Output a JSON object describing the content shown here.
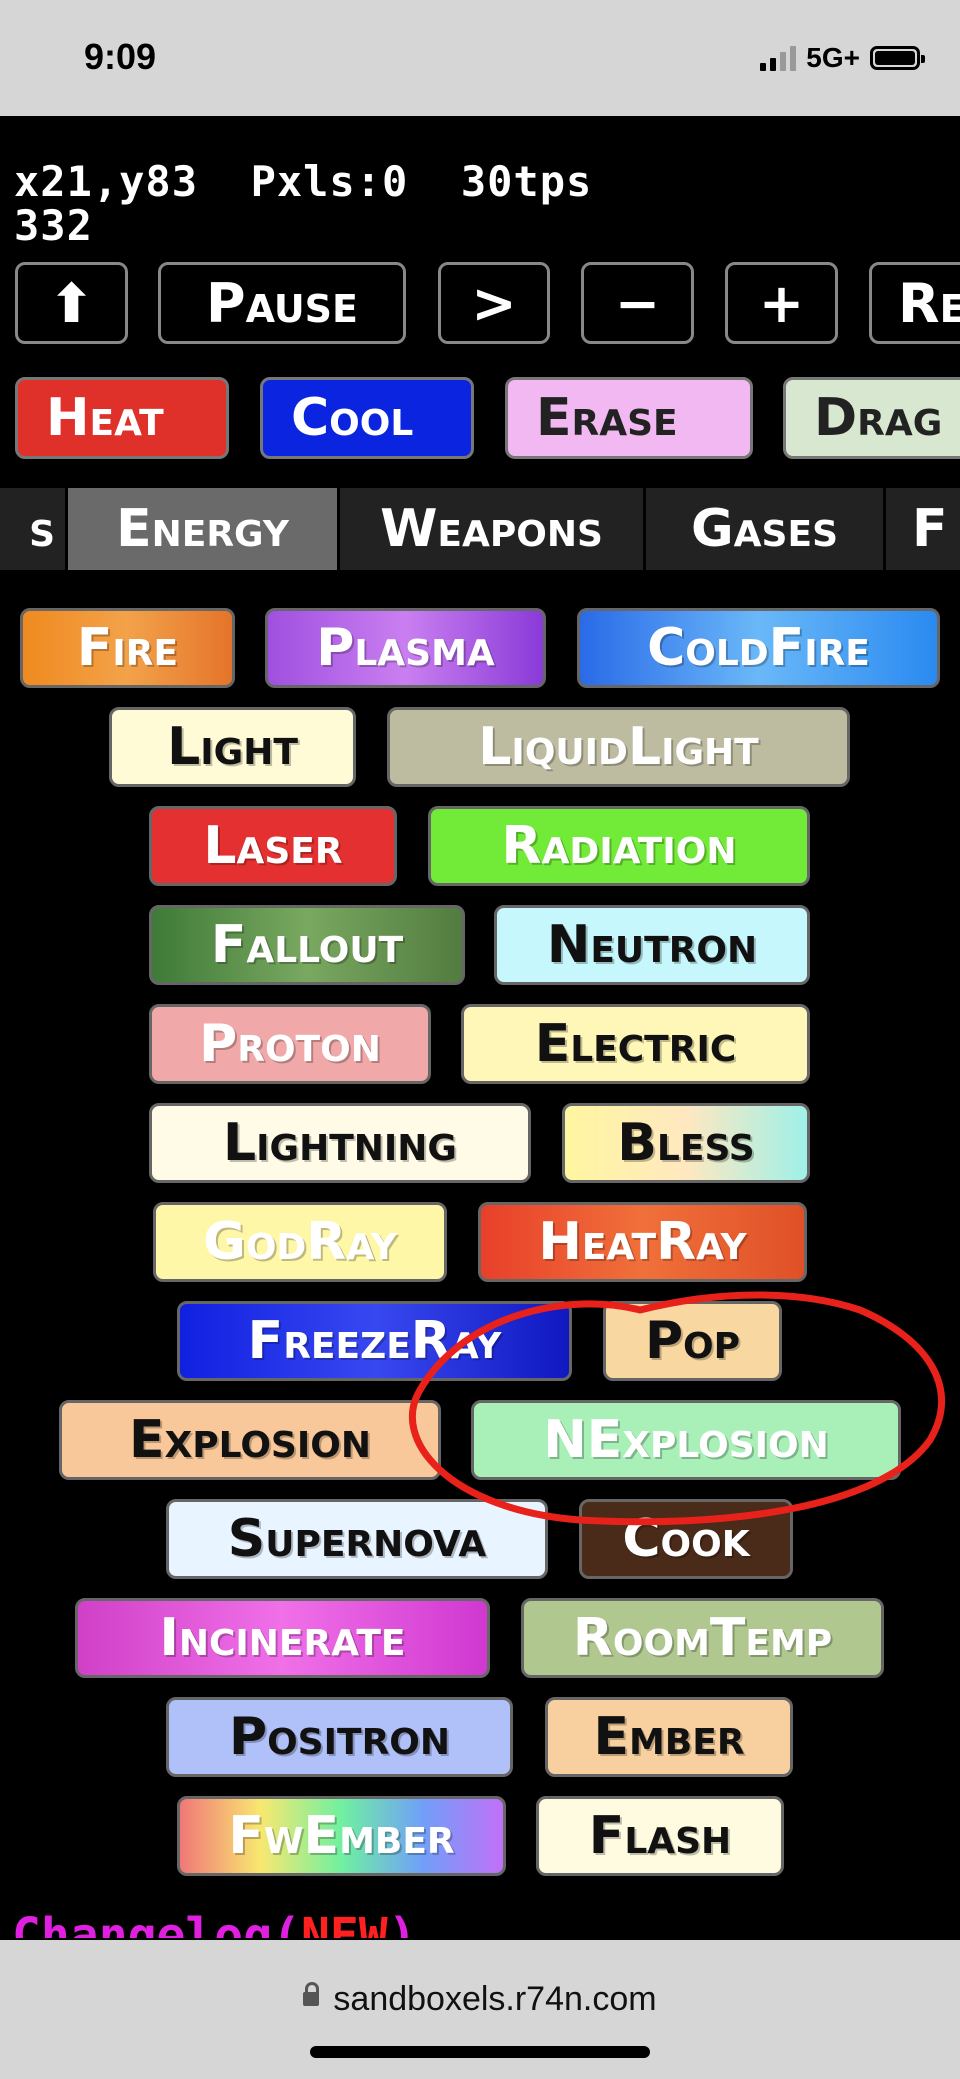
{
  "status_bar": {
    "time": "9:09",
    "network": "5G+"
  },
  "stats": {
    "line1": "x21,y83  Pxls:0  30tps",
    "line2": "332"
  },
  "controls": [
    {
      "label": "⬆",
      "name": "up-arrow-button"
    },
    {
      "label": "Pause",
      "name": "pause-button"
    },
    {
      "label": ">",
      "name": "step-button"
    },
    {
      "label": "−",
      "name": "zoom-out-button"
    },
    {
      "label": "+",
      "name": "zoom-in-button"
    },
    {
      "label": "Re",
      "name": "reset-button"
    }
  ],
  "tools": [
    {
      "label": "Heat",
      "bg": "#e0302a",
      "color": "#fff"
    },
    {
      "label": "Cool",
      "bg": "#0a24e0",
      "color": "#fff"
    },
    {
      "label": "Erase",
      "bg": "#f2b8f2",
      "color": "#222"
    },
    {
      "label": "Drag",
      "bg": "#d8e8d0",
      "color": "#222"
    }
  ],
  "tabs": [
    {
      "label": "s",
      "active": false
    },
    {
      "label": "Energy",
      "active": true
    },
    {
      "label": "Weapons",
      "active": false
    },
    {
      "label": "Gases",
      "active": false
    },
    {
      "label": "F",
      "active": false
    }
  ],
  "elements": [
    {
      "label": "Fire",
      "bg": "linear-gradient(90deg,#ef8a1f,#f3a24a,#e4742a)",
      "color": "#fff"
    },
    {
      "label": "Plasma",
      "bg": "linear-gradient(90deg,#a050e0,#c97ff0,#8a3ad8)",
      "color": "#fff"
    },
    {
      "label": "ColdFire",
      "bg": "linear-gradient(90deg,#2a6ae8,#6ab8f8,#2a8af0)",
      "color": "#fff"
    },
    {
      "label": "Light",
      "bg": "#fffbd6",
      "color": "#111"
    },
    {
      "label": "LiquidLight",
      "bg": "#bebca0",
      "color": "#fff"
    },
    {
      "label": "Laser",
      "bg": "#e43030",
      "color": "#fff"
    },
    {
      "label": "Radiation",
      "bg": "#72ea38",
      "color": "#fff"
    },
    {
      "label": "Fallout",
      "bg": "linear-gradient(90deg,#3f7a38,#79a860,#527c40)",
      "color": "#fff"
    },
    {
      "label": "Neutron",
      "bg": "#c5f7fc",
      "color": "#111"
    },
    {
      "label": "Proton",
      "bg": "#f0a8a8",
      "color": "#fff"
    },
    {
      "label": "Electric",
      "bg": "#fff7b8",
      "color": "#111"
    },
    {
      "label": "Lightning",
      "bg": "#fffbe6",
      "color": "#111"
    },
    {
      "label": "Bless",
      "bg": "linear-gradient(90deg,#fff6a0,#ffe8c0,#9ff0e8)",
      "color": "#111"
    },
    {
      "label": "GodRay",
      "bg": "#fff7a8",
      "color": "#fff"
    },
    {
      "label": "HeatRay",
      "bg": "linear-gradient(90deg,#e8402a,#f0703a,#e05028)",
      "color": "#fff"
    },
    {
      "label": "FreezeRay",
      "bg": "linear-gradient(90deg,#1020e0,#3848f0,#1018c0)",
      "color": "#fff"
    },
    {
      "label": "Pop",
      "bg": "#f8d8a0",
      "color": "#111"
    },
    {
      "label": "Explosion",
      "bg": "#f8c89a",
      "color": "#111"
    },
    {
      "label": "NExplosion",
      "bg": "#a8f0b8",
      "color": "#fff"
    },
    {
      "label": "Supernova",
      "bg": "#e8f4ff",
      "color": "#111"
    },
    {
      "label": "Cook",
      "bg": "#4a2a18",
      "color": "#fff"
    },
    {
      "label": "Incinerate",
      "bg": "linear-gradient(90deg,#d040c8,#f070e8,#d038d0)",
      "color": "#fff"
    },
    {
      "label": "RoomTemp",
      "bg": "#b0c890",
      "color": "#fff"
    },
    {
      "label": "Positron",
      "bg": "#b0c0f8",
      "color": "#111"
    },
    {
      "label": "Ember",
      "bg": "#f8d0a0",
      "color": "#111"
    },
    {
      "label": "FwEmber",
      "bg": "linear-gradient(90deg,#f07878,#f8e870,#70f0a0,#70a0f8,#c070f8)",
      "color": "#fff"
    },
    {
      "label": "Flash",
      "bg": "#fffbe0",
      "color": "#111"
    }
  ],
  "changelog": {
    "text": "Changelog(",
    "new": "NEW",
    "close": ")"
  },
  "browser": {
    "url": "sandboxels.r74n.com"
  }
}
